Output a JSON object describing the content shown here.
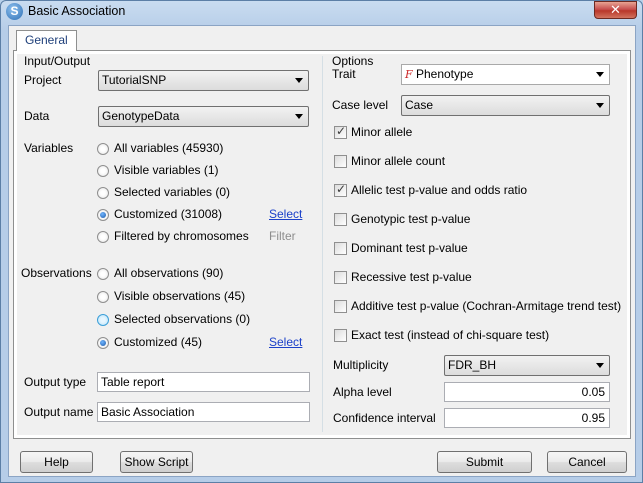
{
  "window": {
    "title": "Basic Association",
    "close_label": "✕"
  },
  "tab": {
    "label": "General"
  },
  "input_output": {
    "group_label": "Input/Output",
    "project": {
      "label": "Project",
      "value": "TutorialSNP"
    },
    "data": {
      "label": "Data",
      "value": "GenotypeData"
    },
    "variables": {
      "label": "Variables",
      "options": [
        "All variables (45930)",
        "Visible variables (1)",
        "Selected variables (0)",
        "Customized (31008)",
        "Filtered by chromosomes"
      ],
      "selected": "Customized (31008)",
      "select_link": "Select",
      "filter_link": "Filter"
    },
    "observations": {
      "label": "Observations",
      "options": [
        "All observations (90)",
        "Visible observations (45)",
        "Selected observations (0)",
        "Customized (45)"
      ],
      "selected": "Customized (45)",
      "select_link": "Select"
    },
    "output_type": {
      "label": "Output type",
      "value": "Table report"
    },
    "output_name": {
      "label": "Output name",
      "value": "Basic Association"
    }
  },
  "options": {
    "group_label": "Options",
    "trait": {
      "label": "Trait",
      "value": "Phenotype",
      "icon": "function-icon"
    },
    "case_level": {
      "label": "Case level",
      "value": "Case"
    },
    "checkboxes": [
      {
        "label": "Minor allele",
        "checked": true
      },
      {
        "label": "Minor allele count",
        "checked": false
      },
      {
        "label": "Allelic test p-value and odds ratio",
        "checked": true
      },
      {
        "label": "Genotypic test p-value",
        "checked": false
      },
      {
        "label": "Dominant test p-value",
        "checked": false
      },
      {
        "label": "Recessive test p-value",
        "checked": false
      },
      {
        "label": "Additive test p-value (Cochran-Armitage trend test)",
        "checked": false
      },
      {
        "label": "Exact test (instead of chi-square test)",
        "checked": false
      }
    ],
    "multiplicity": {
      "label": "Multiplicity",
      "value": "FDR_BH"
    },
    "alpha_level": {
      "label": "Alpha level",
      "value": "0.05"
    },
    "confidence_interval": {
      "label": "Confidence interval",
      "value": "0.95"
    }
  },
  "buttons": {
    "help": "Help",
    "show_script": "Show Script",
    "submit": "Submit",
    "cancel": "Cancel"
  }
}
